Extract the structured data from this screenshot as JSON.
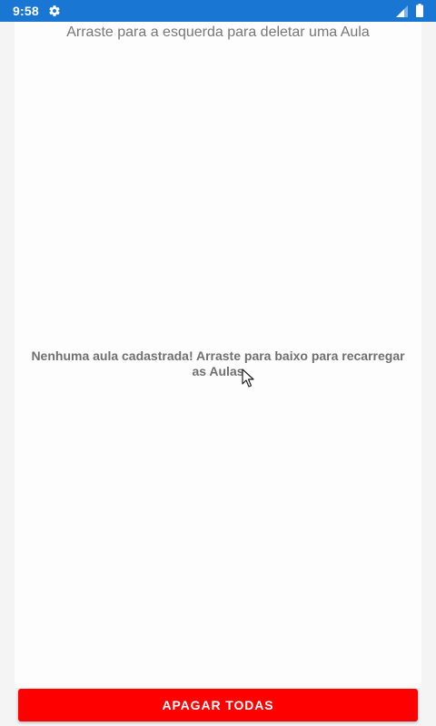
{
  "status_bar": {
    "time": "9:58",
    "settings_icon": "gear-icon",
    "signal_icon": "signal-icon",
    "battery_icon": "battery-icon",
    "background_color": "#1976d2"
  },
  "main": {
    "hint": "Arraste para a esquerda para deletar uma Aula",
    "empty_message": "Nenhuma aula cadastrada! Arraste para baixo para recarregar as Aulas",
    "cursor_icon": "mouse-pointer-icon"
  },
  "footer": {
    "delete_all_label": "APAGAR TODAS",
    "button_color": "#ff0000"
  }
}
